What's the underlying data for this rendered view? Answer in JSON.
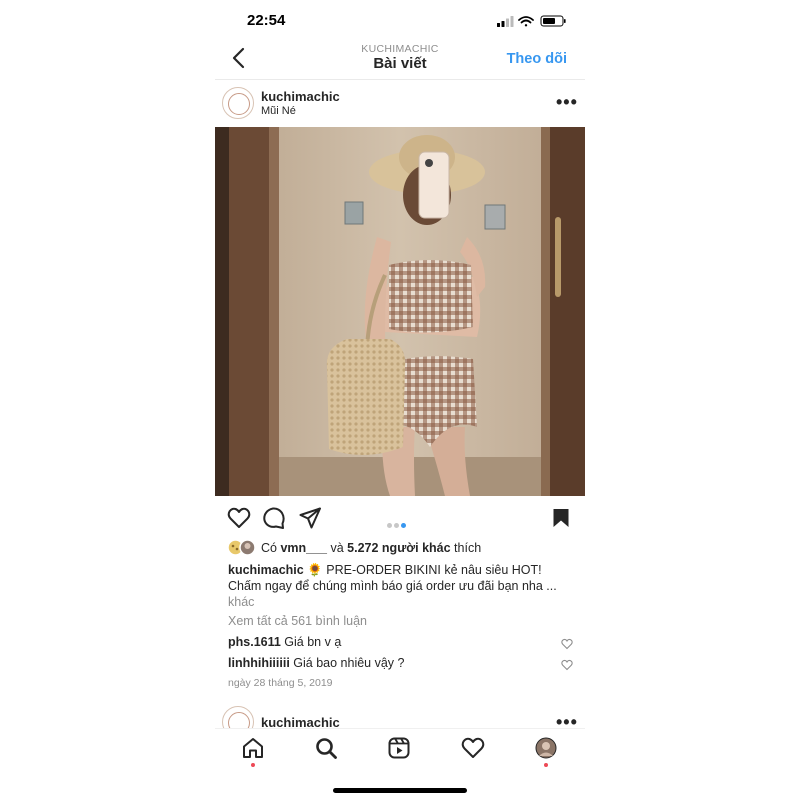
{
  "status": {
    "time": "22:54"
  },
  "header": {
    "subtitle": "KUCHIMACHIC",
    "title": "Bài viết",
    "follow_label": "Theo dõi"
  },
  "post": {
    "username": "kuchimachic",
    "location": "Mũi Né",
    "photo_alt": "",
    "likes": {
      "prefix": "Có ",
      "user": "vmn___",
      "middle": " và ",
      "count": "5.272 người khác",
      "suffix": " thích"
    },
    "caption": {
      "username": "kuchimachic",
      "emoji": "🌻",
      "line1": " PRE-ORDER BIKINI kẻ nâu siêu HOT!",
      "line2": "Chấm ngay để chúng mình báo giá order ưu đãi bạn nha ...",
      "more": "khác"
    },
    "view_comments": "Xem tất cả 561 bình luận",
    "comments": [
      {
        "user": "phs.1611",
        "text": " Giá bn v ạ"
      },
      {
        "user": "linhhihiiiiii",
        "text": " Giá bao nhiêu vậy ?"
      }
    ],
    "date": "ngày 28 tháng 5, 2019",
    "carousel": {
      "count": 3,
      "active": 3
    }
  },
  "next_post": {
    "username": "kuchimachic"
  },
  "colors": {
    "accent": "#3797f0",
    "notification": "#ed4956",
    "text": "#262626",
    "muted": "#8e8e8e"
  }
}
